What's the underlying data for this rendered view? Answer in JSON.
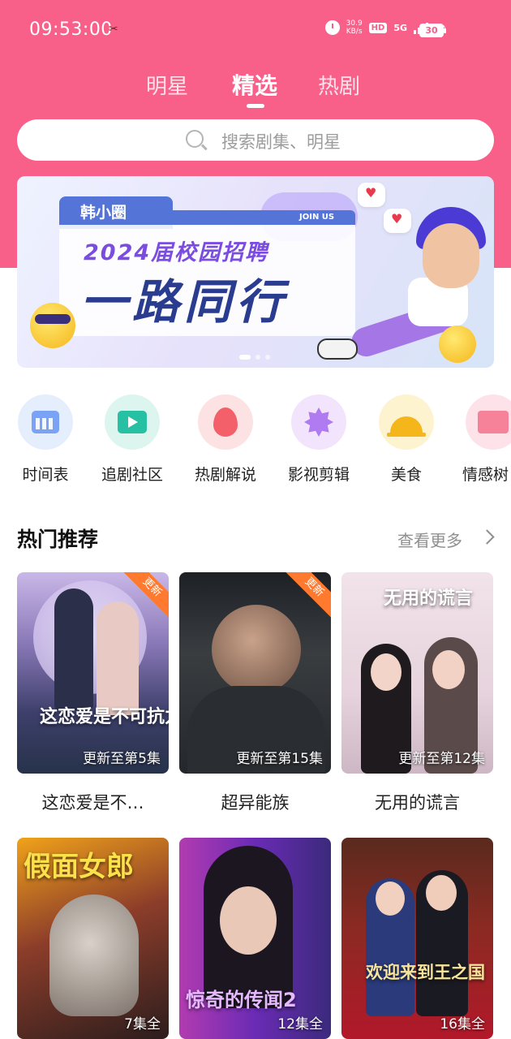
{
  "status_bar": {
    "time": "09:53:00",
    "net_speed_value": "30.9",
    "net_speed_unit": "KB/s",
    "hd_label": "HD",
    "network_label": "5G",
    "battery": "30"
  },
  "tabs": [
    {
      "label": "明星",
      "active": false
    },
    {
      "label": "精选",
      "active": true
    },
    {
      "label": "热剧",
      "active": false
    }
  ],
  "search": {
    "placeholder": "搜索剧集、明星"
  },
  "banner": {
    "brand": "韩小圈",
    "join_us": "JOIN US",
    "line1": "2024届校园招聘",
    "line2": "一路同行"
  },
  "categories": [
    {
      "label": "时间表",
      "icon": "calendar-icon",
      "bg": "#e4eefc"
    },
    {
      "label": "追剧社区",
      "icon": "tv-icon",
      "bg": "#dcf5ee"
    },
    {
      "label": "热剧解说",
      "icon": "flame-icon",
      "bg": "#fde2e4"
    },
    {
      "label": "影视剪辑",
      "icon": "play-badge-icon",
      "bg": "#f1e4fc"
    },
    {
      "label": "美食",
      "icon": "cloche-icon",
      "bg": "#fdf3cf"
    },
    {
      "label": "情感树",
      "icon": "mail-heart-icon",
      "bg": "#fde2ea"
    }
  ],
  "section": {
    "title": "热门推荐",
    "more": "查看更多"
  },
  "dramas": [
    {
      "title": "这恋爱是不…",
      "caption": "更新至第5集",
      "badge": "更新",
      "art_text": "这恋爱是不可抗力"
    },
    {
      "title": "超异能族",
      "caption": "更新至第15集",
      "badge": "更新",
      "art_text": ""
    },
    {
      "title": "无用的谎言",
      "caption": "更新至第12集",
      "badge": "",
      "art_text": "无用的谎言"
    },
    {
      "title": "",
      "caption": "7集全",
      "badge": "",
      "art_text": "假面女郎"
    },
    {
      "title": "",
      "caption": "12集全",
      "badge": "",
      "art_text": "惊奇的传闻2"
    },
    {
      "title": "",
      "caption": "16集全",
      "badge": "",
      "art_text": "欢迎来到王之国"
    }
  ],
  "colors": {
    "brand": "#f8608a",
    "badge": "#ff7a2e"
  }
}
